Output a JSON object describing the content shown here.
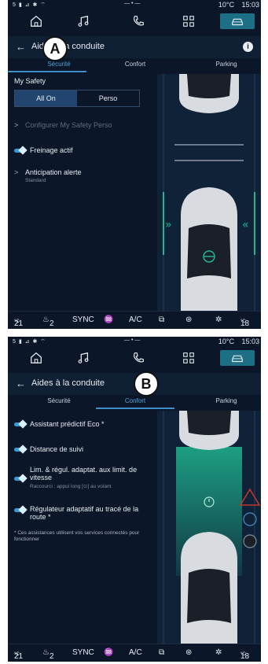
{
  "screens": [
    {
      "callout": "A",
      "status": {
        "left": "5 ▮ ⊿ ✱ ⌔",
        "center": "— • —",
        "temp": "10°C",
        "time": "15:03"
      },
      "header": {
        "title": "Aides à la conduite"
      },
      "tabs": [
        {
          "label": "Sécurité"
        },
        {
          "label": "Confort"
        },
        {
          "label": "Parking"
        }
      ],
      "my_safety": {
        "label": "My Safety",
        "options": [
          "All On",
          "Perso"
        ],
        "selected": "All On"
      },
      "items": [
        {
          "label": "Configurer My Safety Perso",
          "kind": "chevron",
          "disabled": true
        },
        {
          "label": "Freinage actif",
          "kind": "toggle",
          "on": true
        },
        {
          "label": "Anticipation alerte",
          "sub": "Standard",
          "kind": "chevron"
        }
      ],
      "climate": {
        "left_temp": "21",
        "seat": "2",
        "sync": "SYNC",
        "ac": "A/C",
        "right_temp": "18",
        "unit": "°C"
      }
    },
    {
      "callout": "B",
      "status": {
        "left": "5 ▮ ⊿ ✱ ⌔",
        "center": "— • —",
        "temp": "10°C",
        "time": "15:03"
      },
      "header": {
        "title": "Aides à la conduite"
      },
      "tabs": [
        {
          "label": "Sécurité"
        },
        {
          "label": "Confort"
        },
        {
          "label": "Parking"
        }
      ],
      "items": [
        {
          "label": "Assistant prédictif Eco *",
          "kind": "toggle",
          "on": true
        },
        {
          "label": "Distance de suivi",
          "kind": "toggle",
          "on": true
        },
        {
          "label": "Lim. & régul. adaptat. aux limit. de vitesse",
          "sub": "Raccourci : appui long [⊙] au volant",
          "kind": "toggle",
          "on": true
        },
        {
          "label": "Régulateur adaptatif au tracé de la route *",
          "kind": "toggle",
          "on": true
        }
      ],
      "footnote": "* Ces assistances utilisent vos services connectés pour fonctionner",
      "climate": {
        "left_temp": "21",
        "seat": "2",
        "sync": "SYNC",
        "ac": "A/C",
        "right_temp": "18",
        "unit": "°C"
      }
    }
  ],
  "colors": {
    "accent": "#3c8fc7",
    "active_nav": "#1d6f86",
    "lane_green": "#1fb58f",
    "warning_red": "#c0392b"
  },
  "icons": [
    "home-icon",
    "music-icon",
    "phone-icon",
    "apps-icon",
    "car-icon",
    "back-arrow-icon",
    "info-icon"
  ]
}
